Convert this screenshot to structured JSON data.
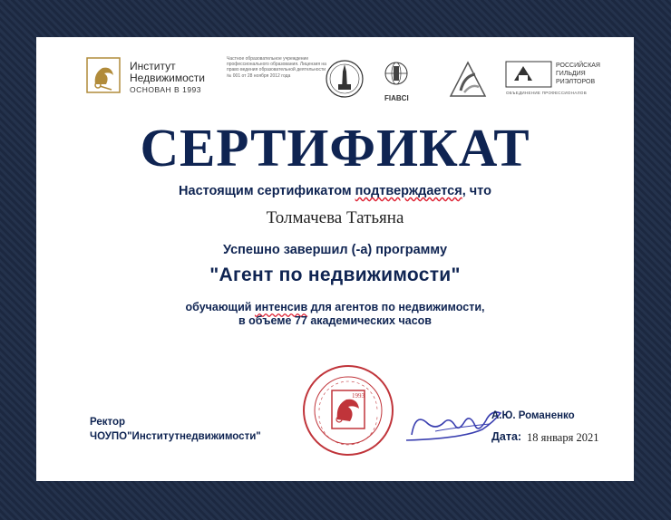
{
  "header": {
    "institute_name_line1": "Институт",
    "institute_name_line2": "Недвижимости",
    "institute_founded": "ОСНОВАН В 1993",
    "license_text": "Частное образовательное учреждение профессионального образования. Лицензия на право ведения образовательной деятельности № 001 от 28 ноября 2012 года",
    "fiabci_label": "FIABCI",
    "guild_line1": "РОССИЙСКАЯ",
    "guild_line2": "ГИЛЬДИЯ",
    "guild_line3": "РИЭЛТОРОВ",
    "guild_sub": "ОБЪЕДИНЕНИЕ ПРОФЕССИОНАЛОВ"
  },
  "certificate": {
    "title": "СЕРТИФИКАТ",
    "confirm_part1": "Настоящим сертификатом",
    "confirm_part2": "подтверждается",
    "confirm_part3": ",  что",
    "holder_name": "Толмачева Татьяна",
    "completed_text": "Успешно завершил (-а) программу",
    "program_name": "\"Агент по недвижимости\"",
    "desc_part1": "обучающий",
    "desc_part2": "интенсив",
    "desc_part3": "для агентов по недвижимости,",
    "desc_line2": "в объеме 77 академических часов"
  },
  "footer": {
    "rector_title": "Ректор",
    "org_name": "ЧОУПО\"Институтнедвижимости\"",
    "signer": "А.Ю. Романенко",
    "date_label": "Дата:",
    "date_value": "18 января 2021"
  },
  "seal": {
    "year": "1993"
  },
  "colors": {
    "navy": "#0f2452",
    "seal_red": "#c0343a",
    "frame": "#1c2840",
    "signature": "#3a3fb0"
  }
}
